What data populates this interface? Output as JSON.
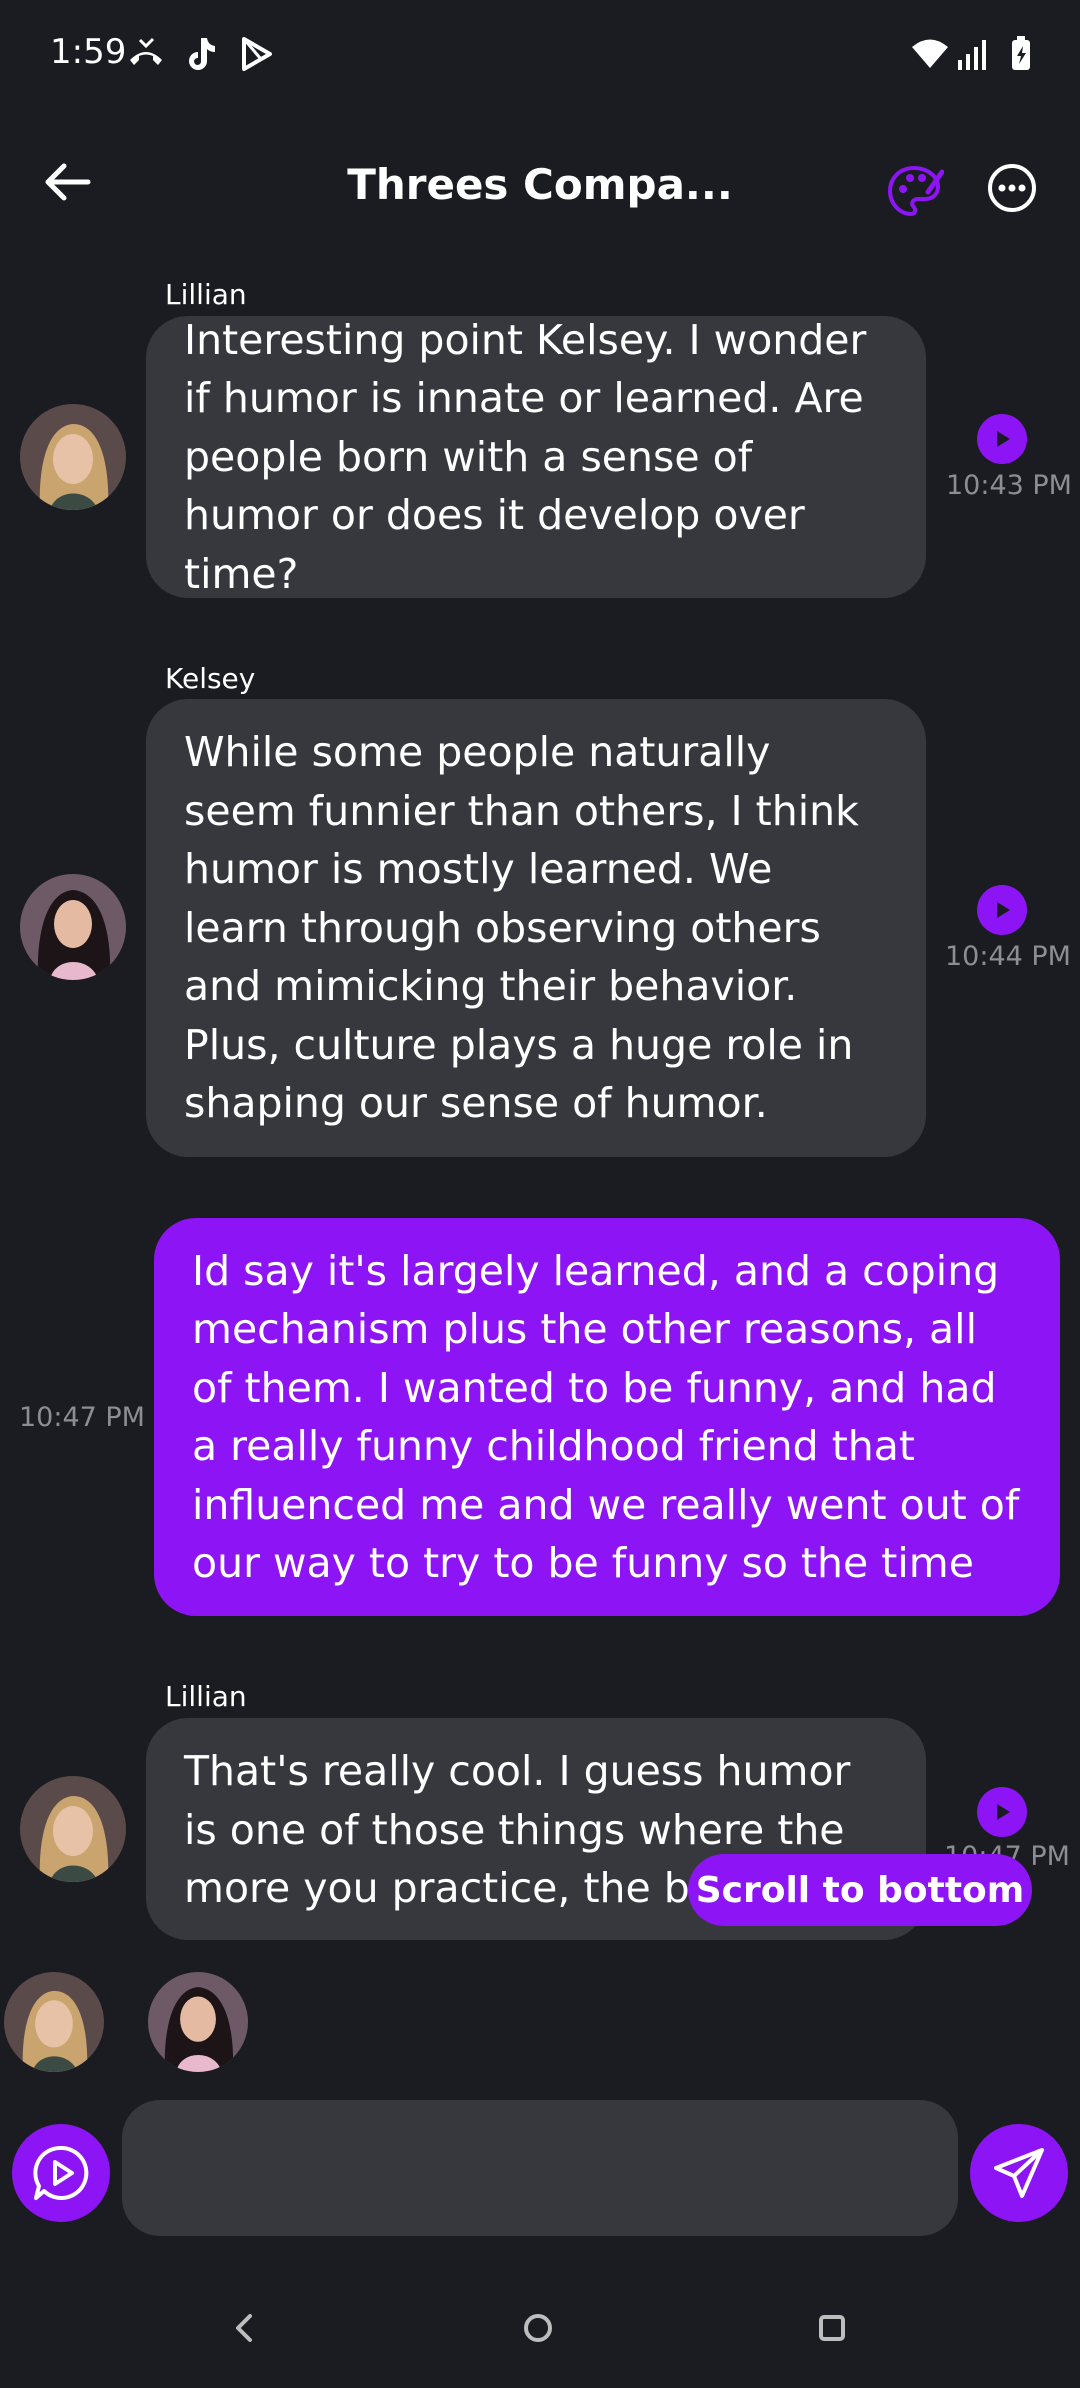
{
  "status": {
    "time": "1:59"
  },
  "header": {
    "title": "Threes Compa..."
  },
  "messages": [
    {
      "sender": "Lillian",
      "text": "Interesting point Kelsey. I wonder if humor is innate or learned. Are people born with a sense of humor or does it develop over time?",
      "time": "10:43 PM"
    },
    {
      "sender": "Kelsey",
      "text": "While some people naturally seem funnier than others, I think humor is mostly learned. We learn through observing others and mimicking their behavior. Plus, culture plays a huge role in shaping our sense of humor.",
      "time": "10:44 PM"
    },
    {
      "text": "Id say it's largely learned, and a coping mechanism plus the other reasons, all of them. I wanted to be funny, and had a really funny childhood friend that influenced me and we really went out of our way to try to be funny so the time",
      "time": "10:47 PM"
    },
    {
      "sender": "Lillian",
      "text": "That's really cool. I guess humor is one of those things where the more you practice, the better yo",
      "time": "10:47 PM"
    }
  ],
  "scroll_button": {
    "label": "Scroll to bottom"
  },
  "composer": {
    "value": ""
  },
  "colors": {
    "accent": "#8d15f5",
    "bubble": "#36383e",
    "background": "#1b1c21"
  }
}
